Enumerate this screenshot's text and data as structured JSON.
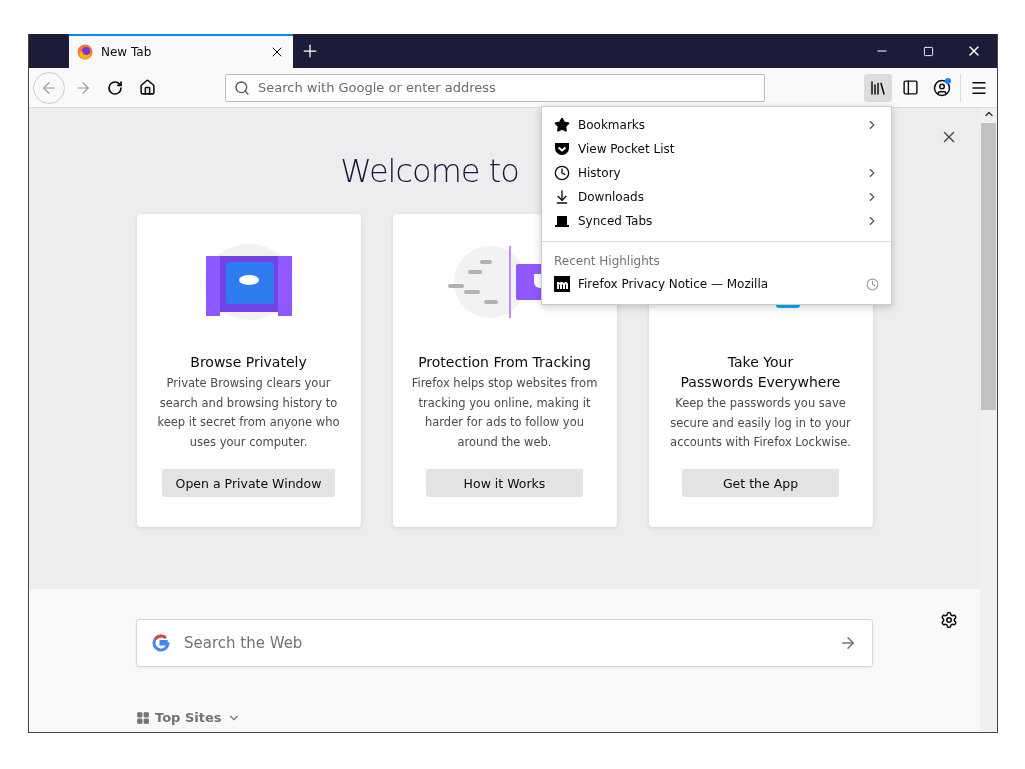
{
  "tabs": [
    {
      "title": "New Tab",
      "selected": true
    }
  ],
  "address_bar": {
    "placeholder": "Search with Google or enter address"
  },
  "toolbar": {
    "library_open": true,
    "account_notification": true
  },
  "library_menu": {
    "items": [
      {
        "kind": "star",
        "label": "Bookmarks",
        "submenu": true
      },
      {
        "kind": "pocket",
        "label": "View Pocket List",
        "submenu": false
      },
      {
        "kind": "clock",
        "label": "History",
        "submenu": true
      },
      {
        "kind": "download",
        "label": "Downloads",
        "submenu": true
      },
      {
        "kind": "laptop",
        "label": "Synced Tabs",
        "submenu": true
      }
    ],
    "section_title": "Recent Highlights",
    "highlights": [
      {
        "title": "Firefox Privacy Notice — Mozilla"
      }
    ]
  },
  "welcome": {
    "heading": "Welcome to"
  },
  "cards": [
    {
      "kind": "private",
      "title_lines": [
        "Browse Privately"
      ],
      "body_lines": [
        "Private Browsing clears your",
        "search and browsing history to",
        "keep it secret from anyone who",
        "uses your computer."
      ],
      "button": "Open a Private Window"
    },
    {
      "kind": "tracking",
      "title_lines": [
        "Protection From Tracking"
      ],
      "body_lines": [
        "Firefox helps stop websites from",
        "tracking you online, making it",
        "harder for ads to follow you",
        "around the web."
      ],
      "button": "How it Works"
    },
    {
      "kind": "passwords",
      "title_lines": [
        "Take Your",
        "Passwords Everywhere"
      ],
      "body_lines": [
        "Keep the passwords you save",
        "secure and easily log in to your",
        "accounts with Firefox Lockwise."
      ],
      "button": "Get the App"
    }
  ],
  "web_search": {
    "placeholder": "Search the Web"
  },
  "top_sites": {
    "label": "Top Sites",
    "expanded": true
  }
}
